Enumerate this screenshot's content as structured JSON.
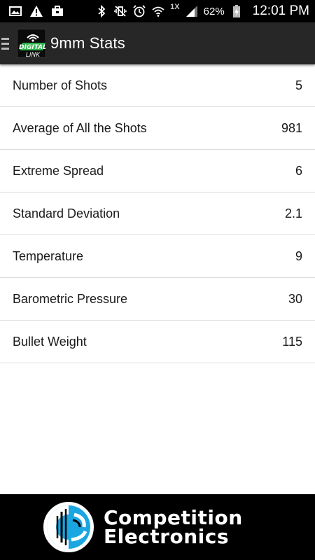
{
  "status_bar": {
    "signal_badge": "1X",
    "battery_percent": "62%",
    "time": "12:01 PM"
  },
  "app_bar": {
    "title": "9mm Stats",
    "logo_text_top": "DIGITAL",
    "logo_text_bottom": "LINK"
  },
  "stats": [
    {
      "label": "Number of Shots",
      "value": "5"
    },
    {
      "label": "Average of All the Shots",
      "value": "981"
    },
    {
      "label": "Extreme Spread",
      "value": "6"
    },
    {
      "label": "Standard Deviation",
      "value": "2.1"
    },
    {
      "label": "Temperature",
      "value": "9"
    },
    {
      "label": "Barometric Pressure",
      "value": "30"
    },
    {
      "label": "Bullet Weight",
      "value": "115"
    }
  ],
  "footer": {
    "brand_line1": "Competition",
    "brand_line2": "Electronics"
  },
  "colors": {
    "status_bar_bg": "#000000",
    "app_bar_bg": "#272727",
    "logo_green": "#2db24a",
    "footer_blue": "#1aa6e0"
  }
}
